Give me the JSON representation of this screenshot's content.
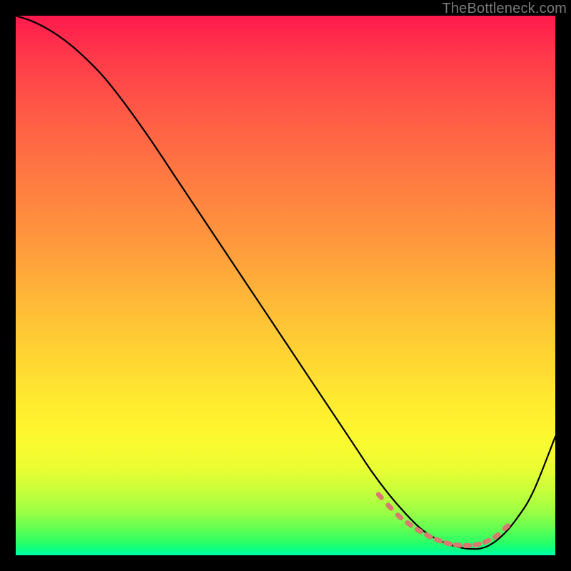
{
  "watermark": "TheBottleneck.com",
  "colors": {
    "frame": "#000000",
    "curve": "#000000",
    "bead": "#d97a6f",
    "gradient_top": "#ff1a4d",
    "gradient_bottom": "#00ffb0"
  },
  "chart_data": {
    "type": "line",
    "title": "",
    "xlabel": "",
    "ylabel": "",
    "xlim": [
      0,
      100
    ],
    "ylim": [
      0,
      100
    ],
    "grid": false,
    "legend": false,
    "annotations": [
      "TheBottleneck.com"
    ],
    "series": [
      {
        "name": "curve",
        "x": [
          0,
          3,
          6,
          9,
          12,
          16,
          20,
          25,
          30,
          35,
          40,
          45,
          50,
          55,
          60,
          63,
          66,
          69,
          72,
          75,
          78,
          81,
          84,
          87,
          90,
          93,
          96,
          100
        ],
        "y": [
          100,
          99,
          97.5,
          95.5,
          93,
          89,
          84,
          77,
          69.5,
          62,
          54.5,
          47,
          39.5,
          32,
          24.5,
          20,
          15.5,
          11.5,
          8,
          5,
          3,
          1.8,
          1.2,
          1.5,
          3.5,
          7,
          12,
          22
        ]
      }
    ],
    "beads": {
      "name": "valley-markers",
      "x": [
        67.5,
        69.3,
        71.1,
        72.9,
        74.7,
        76.5,
        78.3,
        80.1,
        81.9,
        83.7,
        85.5,
        87.3,
        89.1,
        90.9
      ],
      "y": [
        11.0,
        9.0,
        7.2,
        5.8,
        4.6,
        3.6,
        2.8,
        2.2,
        1.9,
        1.8,
        2.0,
        2.6,
        3.6,
        5.2
      ]
    }
  }
}
